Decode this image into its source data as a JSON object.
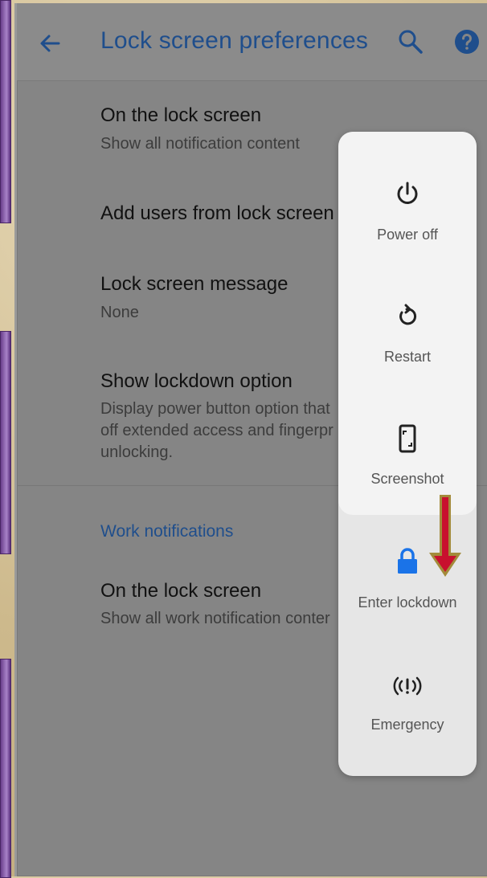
{
  "header": {
    "title": "Lock screen preferences",
    "back_icon": "arrow-back-icon",
    "search_icon": "search-icon",
    "help_icon": "help-icon"
  },
  "settings": {
    "items": [
      {
        "title": "On the lock screen",
        "subtitle": "Show all notification content"
      },
      {
        "title": "Add users from lock screen",
        "subtitle": ""
      },
      {
        "title": "Lock screen message",
        "subtitle": "None"
      },
      {
        "title": "Show lockdown option",
        "subtitle": "Display power button option that\noff extended access and fingerpr\nunlocking."
      }
    ],
    "section_header": "Work notifications",
    "work_item": {
      "title": "On the lock screen",
      "subtitle": "Show all work notification conter"
    }
  },
  "power_menu": {
    "items": [
      {
        "label": "Power off",
        "icon": "power-icon"
      },
      {
        "label": "Restart",
        "icon": "restart-icon"
      },
      {
        "label": "Screenshot",
        "icon": "screenshot-icon"
      },
      {
        "label": "Enter lockdown",
        "icon": "lock-icon"
      },
      {
        "label": "Emergency",
        "icon": "emergency-icon"
      }
    ]
  },
  "colors": {
    "accent": "#1f4e8c",
    "lock_icon": "#1a73e8",
    "arrow_fill": "#c8102e",
    "arrow_border": "#a38b3a"
  }
}
